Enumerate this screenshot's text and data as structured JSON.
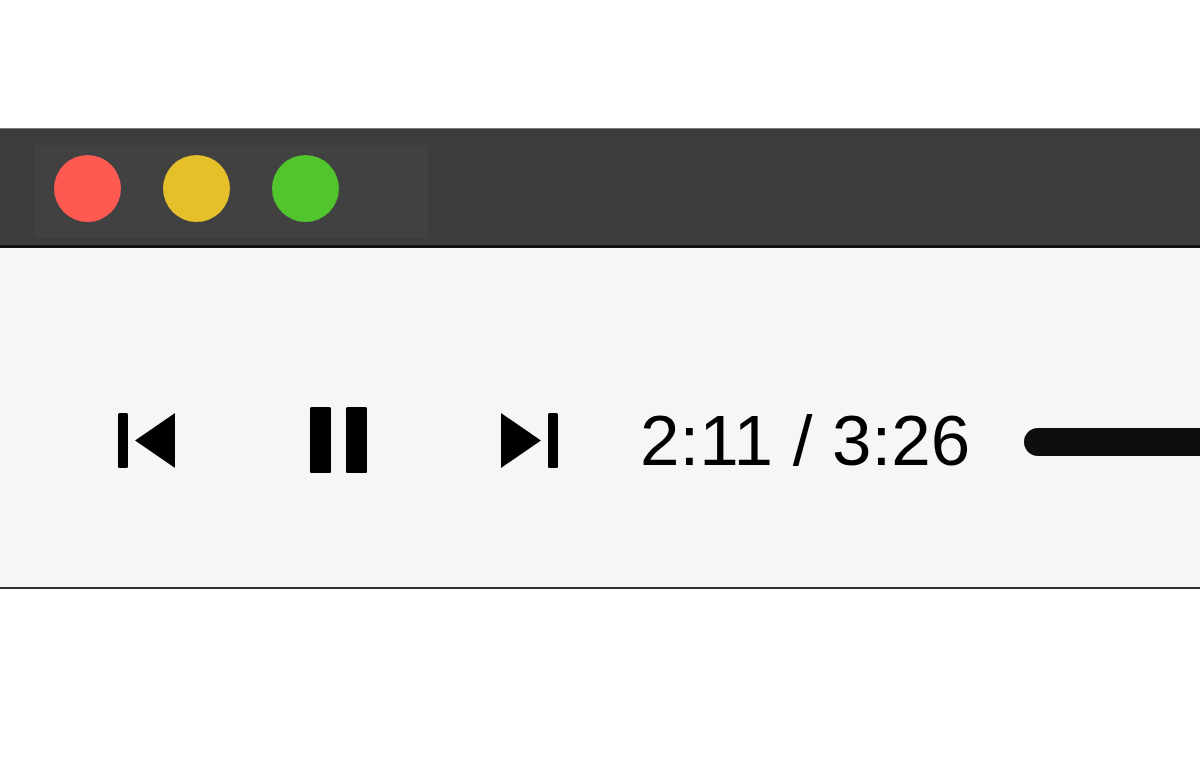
{
  "window": {
    "controls": [
      {
        "color": "#fe5a52"
      },
      {
        "color": "#e6c02a"
      },
      {
        "color": "#51c42e"
      }
    ]
  },
  "player": {
    "playing": true,
    "time": "2:11 / 3:26"
  }
}
